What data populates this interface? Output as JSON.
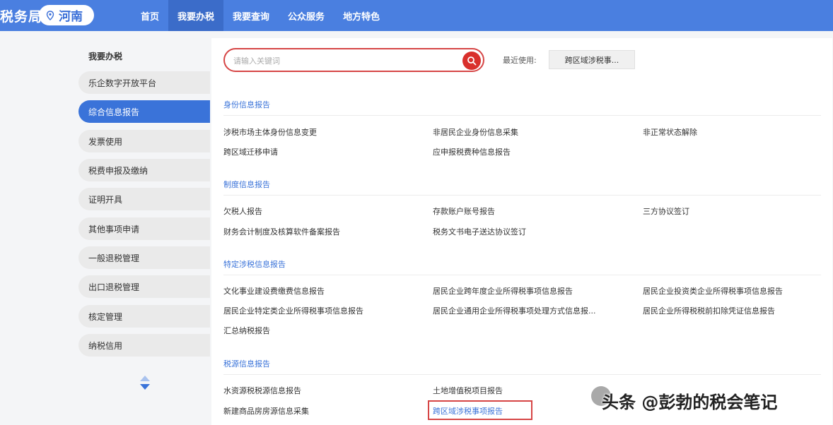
{
  "header": {
    "brand": "税务局",
    "region": "河南",
    "nav": [
      {
        "label": "首页",
        "active": false
      },
      {
        "label": "我要办税",
        "active": true
      },
      {
        "label": "我要查询",
        "active": false
      },
      {
        "label": "公众服务",
        "active": false
      },
      {
        "label": "地方特色",
        "active": false
      }
    ]
  },
  "sidebar": {
    "title": "我要办税",
    "items": [
      {
        "label": "乐企数字开放平台",
        "active": false
      },
      {
        "label": "综合信息报告",
        "active": true
      },
      {
        "label": "发票使用",
        "active": false
      },
      {
        "label": "税费申报及缴纳",
        "active": false
      },
      {
        "label": "证明开具",
        "active": false
      },
      {
        "label": "其他事项申请",
        "active": false
      },
      {
        "label": "一般退税管理",
        "active": false
      },
      {
        "label": "出口退税管理",
        "active": false
      },
      {
        "label": "核定管理",
        "active": false
      },
      {
        "label": "纳税信用",
        "active": false
      }
    ]
  },
  "search": {
    "placeholder": "请输入关键词",
    "recent_label": "最近使用:",
    "recent_item": "跨区域涉税事..."
  },
  "sections": [
    {
      "title": "身份信息报告",
      "links": [
        "涉税市场主体身份信息变更",
        "非居民企业身份信息采集",
        "非正常状态解除",
        "跨区域迁移申请",
        "应申报税费种信息报告"
      ]
    },
    {
      "title": "制度信息报告",
      "links": [
        "欠税人报告",
        "存款账户账号报告",
        "三方协议签订",
        "财务会计制度及核算软件备案报告",
        "税务文书电子送达协议签订"
      ]
    },
    {
      "title": "特定涉税信息报告",
      "links": [
        "文化事业建设费缴费信息报告",
        "居民企业跨年度企业所得税事项信息报告",
        "居民企业投资类企业所得税事项信息报告",
        "居民企业特定类企业所得税事项信息报告",
        "居民企业通用企业所得税事项处理方式信息报...",
        "居民企业所得税税前扣除凭证信息报告",
        "汇总纳税报告"
      ]
    },
    {
      "title": "税源信息报告",
      "links": [
        "水资源税税源信息报告",
        "土地增值税项目报告",
        "新建商品房房源信息采集",
        "跨区域涉税事项报告"
      ]
    }
  ],
  "watermark": "头条 @彭勃的税会笔记",
  "colors": {
    "header_blue": "#4a7fe0",
    "active_nav": "#3b6cc9",
    "active_sidebar": "#3a73d9",
    "highlight_red": "#d64545",
    "search_button_red": "#d9302c",
    "section_title_blue": "#3a73d9"
  }
}
